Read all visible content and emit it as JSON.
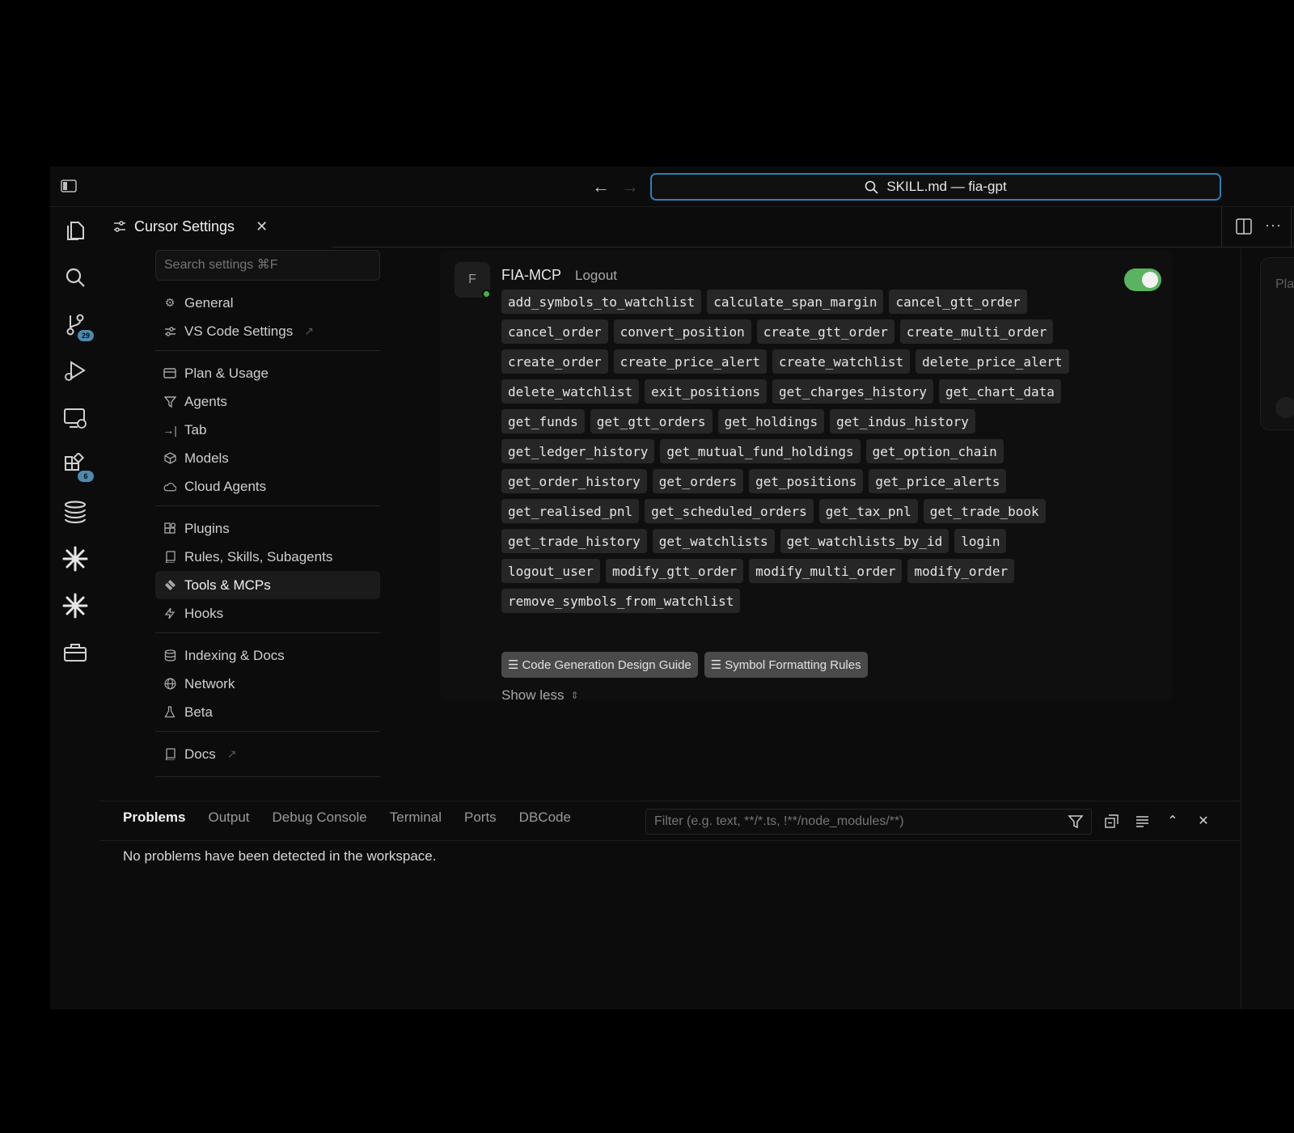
{
  "titlebar": {
    "command_center": "SKILL.md — fia-gpt"
  },
  "activity_bar": {
    "source_control_badge": "29",
    "extensions_badge": "6"
  },
  "tab": {
    "label": "Cursor Settings"
  },
  "settings_nav": {
    "search_placeholder": "Search settings ⌘F",
    "group1": [
      {
        "label": "General",
        "icon": "gear-icon"
      },
      {
        "label": "VS Code Settings",
        "icon": "sliders-icon",
        "external": true
      }
    ],
    "group2": [
      {
        "label": "Plan & Usage",
        "icon": "card-icon"
      },
      {
        "label": "Agents",
        "icon": "funnel-icon"
      },
      {
        "label": "Tab",
        "icon": "tab-arrow-icon"
      },
      {
        "label": "Models",
        "icon": "cube-icon"
      },
      {
        "label": "Cloud Agents",
        "icon": "cloud-icon"
      }
    ],
    "group3": [
      {
        "label": "Plugins",
        "icon": "puzzle-icon"
      },
      {
        "label": "Rules, Skills, Subagents",
        "icon": "book-icon"
      },
      {
        "label": "Tools & MCPs",
        "icon": "tools-icon",
        "active": true
      },
      {
        "label": "Hooks",
        "icon": "bolt-icon"
      }
    ],
    "group4": [
      {
        "label": "Indexing & Docs",
        "icon": "database-icon"
      },
      {
        "label": "Network",
        "icon": "globe-icon"
      },
      {
        "label": "Beta",
        "icon": "flask-icon"
      }
    ],
    "group5": [
      {
        "label": "Docs",
        "icon": "book-icon",
        "external": true
      }
    ]
  },
  "mcp": {
    "avatar_letter": "F",
    "name": "FIA-MCP",
    "logout_label": "Logout",
    "enabled": true,
    "tools": [
      "add_symbols_to_watchlist",
      "calculate_span_margin",
      "cancel_gtt_order",
      "cancel_order",
      "convert_position",
      "create_gtt_order",
      "create_multi_order",
      "create_order",
      "create_price_alert",
      "create_watchlist",
      "delete_price_alert",
      "delete_watchlist",
      "exit_positions",
      "get_charges_history",
      "get_chart_data",
      "get_funds",
      "get_gtt_orders",
      "get_holdings",
      "get_indus_history",
      "get_ledger_history",
      "get_mutual_fund_holdings",
      "get_option_chain",
      "get_order_history",
      "get_orders",
      "get_positions",
      "get_price_alerts",
      "get_realised_pnl",
      "get_scheduled_orders",
      "get_tax_pnl",
      "get_trade_book",
      "get_trade_history",
      "get_watchlists",
      "get_watchlists_by_id",
      "login",
      "logout_user",
      "modify_gtt_order",
      "modify_multi_order",
      "modify_order",
      "remove_symbols_from_watchlist"
    ],
    "rules": [
      "Code Generation Design Guide",
      "Symbol Formatting Rules"
    ],
    "show_less_label": "Show less"
  },
  "right_panel": {
    "label": "Pla"
  },
  "bottom_panel": {
    "tabs": [
      "Problems",
      "Output",
      "Debug Console",
      "Terminal",
      "Ports",
      "DBCode"
    ],
    "active_tab": "Problems",
    "filter_placeholder": "Filter (e.g. text, **/*.ts, !**/node_modules/**)",
    "message": "No problems have been detected in the workspace."
  }
}
